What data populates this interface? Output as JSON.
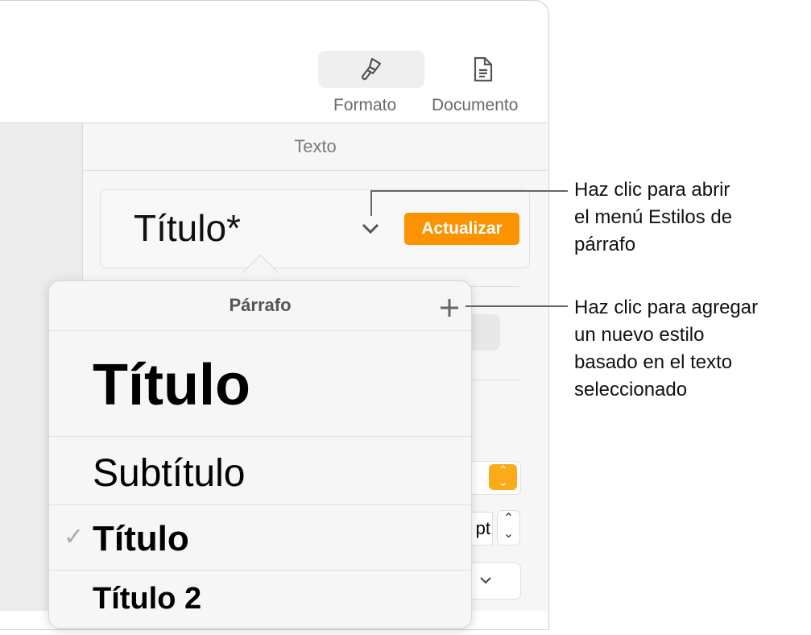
{
  "toolbar": {
    "format_label": "Formato",
    "document_label": "Documento"
  },
  "sidebar": {
    "section_title": "Texto",
    "paragraph_style": "Título*",
    "update_label": "Actualizar",
    "size_unit": "pt"
  },
  "popover": {
    "title": "Párrafo",
    "add_icon": "plus-icon",
    "styles": [
      "Título",
      "Subtítulo",
      "Título",
      "Título 2"
    ],
    "selected_index": 2
  },
  "callouts": {
    "menu": [
      "Haz clic para abrir",
      "el menú Estilos de",
      "párrafo"
    ],
    "add": [
      "Haz clic para agregar",
      "un nuevo estilo",
      "basado en el texto",
      "seleccionado"
    ]
  },
  "colors": {
    "accent": "#fb9300"
  }
}
